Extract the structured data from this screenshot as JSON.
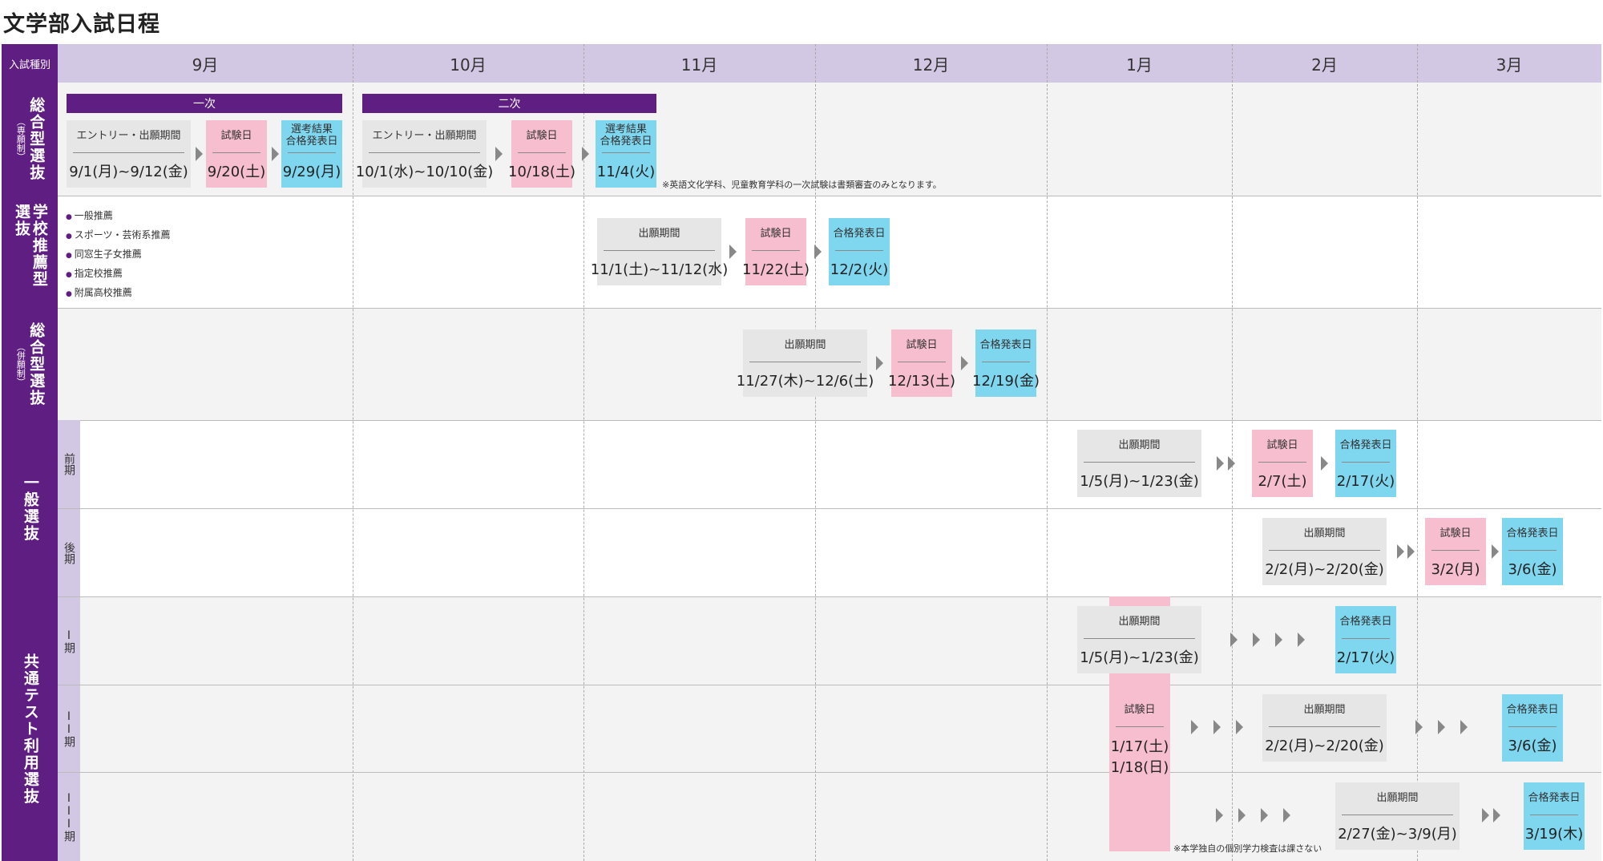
{
  "title": "文学部入試日程",
  "header": {
    "label": "入試種別",
    "months": [
      "9月",
      "10月",
      "11月",
      "12月",
      "1月",
      "2月",
      "3月"
    ]
  },
  "rows": {
    "sogo_sengan": {
      "label": "総合型選抜",
      "sub": "（専願制）",
      "phase1": "一次",
      "phase2": "二次",
      "boxes": [
        {
          "label": "エントリー・出願期間",
          "value": "9/1(月)~9/12(金)"
        },
        {
          "label": "試験日",
          "value": "9/20(土)"
        },
        {
          "label": "選考結果\n合格発表日",
          "value": "9/29(月)"
        },
        {
          "label": "エントリー・出願期間",
          "value": "10/1(水)~10/10(金)"
        },
        {
          "label": "試験日",
          "value": "10/18(土)"
        },
        {
          "label": "選考結果\n合格発表日",
          "value": "11/4(火)"
        }
      ],
      "note": "※英語文化学科、児童教育学科の一次試験は書類審査のみとなります。"
    },
    "gakko_suisen": {
      "label": "学校推薦型選抜",
      "list": [
        "一般推薦",
        "スポーツ・芸術系推薦",
        "同窓生子女推薦",
        "指定校推薦",
        "附属高校推薦"
      ],
      "boxes": [
        {
          "label": "出願期間",
          "value": "11/1(土)~11/12(水)"
        },
        {
          "label": "試験日",
          "value": "11/22(土)"
        },
        {
          "label": "合格発表日",
          "value": "12/2(火)"
        }
      ]
    },
    "sogo_heigan": {
      "label": "総合型選抜",
      "sub": "（併願制）",
      "boxes": [
        {
          "label": "出願期間",
          "value": "11/27(木)~12/6(土)"
        },
        {
          "label": "試験日",
          "value": "12/13(土)"
        },
        {
          "label": "合格発表日",
          "value": "12/19(金)"
        }
      ]
    },
    "ippan": {
      "label": "一般選抜",
      "zenki": {
        "label": "前期",
        "boxes": [
          {
            "label": "出願期間",
            "value": "1/5(月)~1/23(金)"
          },
          {
            "label": "試験日",
            "value": "2/7(土)"
          },
          {
            "label": "合格発表日",
            "value": "2/17(火)"
          }
        ]
      },
      "koki": {
        "label": "後期",
        "boxes": [
          {
            "label": "出願期間",
            "value": "2/2(月)~2/20(金)"
          },
          {
            "label": "試験日",
            "value": "3/2(月)"
          },
          {
            "label": "合格発表日",
            "value": "3/6(金)"
          }
        ]
      }
    },
    "kyotsu": {
      "label": "共通テスト利用選抜",
      "ki1": {
        "label": "I期",
        "boxes": [
          {
            "label": "出願期間",
            "value": "1/5(月)~1/23(金)"
          },
          {
            "label": "合格発表日",
            "value": "2/17(火)"
          }
        ]
      },
      "ki2": {
        "label": "II期",
        "boxes": [
          {
            "label": "出願期間",
            "value": "2/2(月)~2/20(金)"
          },
          {
            "label": "合格発表日",
            "value": "3/6(金)"
          }
        ]
      },
      "ki3": {
        "label": "III期",
        "boxes": [
          {
            "label": "出願期間",
            "value": "2/27(金)~3/9(月)"
          },
          {
            "label": "合格発表日",
            "value": "3/19(木)"
          }
        ]
      },
      "exam": {
        "label": "試験日",
        "value1": "1/17(土)",
        "value2": "1/18(日)"
      },
      "note": "※本学独自の個別学力検査は課さない"
    }
  },
  "colors": {
    "purple": "#5f1e82",
    "lavender": "#d3c8e3",
    "pink": "#f7bed0",
    "cyan": "#7fd6ef",
    "gray": "#e6e6e6"
  }
}
